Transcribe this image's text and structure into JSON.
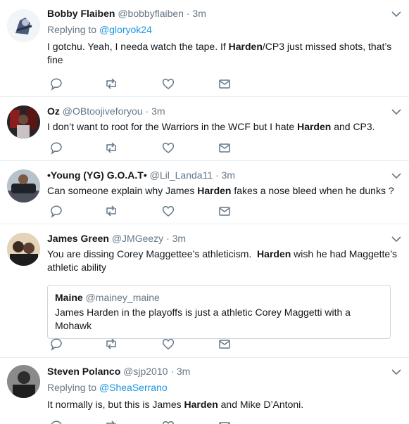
{
  "tweets": [
    {
      "name": "Bobby Flaiben",
      "handle": "@bobbyflaiben",
      "time": "3m",
      "replying_prefix": "Replying to",
      "replying_to": "@gloryok24",
      "text_parts": [
        "I gotchu. Yeah, I needa watch the tape. If ",
        "Harden",
        "/CP3 just missed shots, that’s fine"
      ]
    },
    {
      "name": "Oz",
      "handle": "@OBtoojiveforyou",
      "time": "3m",
      "text_parts": [
        "I don’t want to root for the Warriors in the WCF but I hate ",
        "Harden",
        " and CP3."
      ]
    },
    {
      "name": "•Young (YG) G.O.A.T•",
      "handle": "@Lil_Landa11",
      "time": "3m",
      "text_parts": [
        "Can someone explain why James ",
        "Harden",
        " fakes a nose bleed when he dunks ?"
      ]
    },
    {
      "name": "James Green",
      "handle": "@JMGeezy",
      "time": "3m",
      "text_parts": [
        "You are dissing Corey Maggettee’s athleticism.  ",
        "Harden",
        " wish he had Maggette’s athletic ability"
      ],
      "quote": {
        "name": "Maine",
        "handle": "@mainey_maine",
        "text": "James Harden in the playoffs is just a athletic Corey Maggetti with a Mohawk"
      }
    },
    {
      "name": "Steven Polanco",
      "handle": "@sjp2010",
      "time": "3m",
      "replying_prefix": "Replying to",
      "replying_to": "@SheaSerrano",
      "text_parts": [
        "It normally is, but this is James ",
        "Harden",
        " and Mike D’Antoni."
      ]
    }
  ],
  "separator": "·",
  "icons": {
    "reply": "reply-icon",
    "retweet": "retweet-icon",
    "like": "heart-icon",
    "dm": "envelope-icon",
    "more": "chevron-down-icon"
  },
  "colors": {
    "link": "#1b95e0",
    "muted": "#657786",
    "icon": "#657786",
    "divider": "#e6ecf0"
  }
}
